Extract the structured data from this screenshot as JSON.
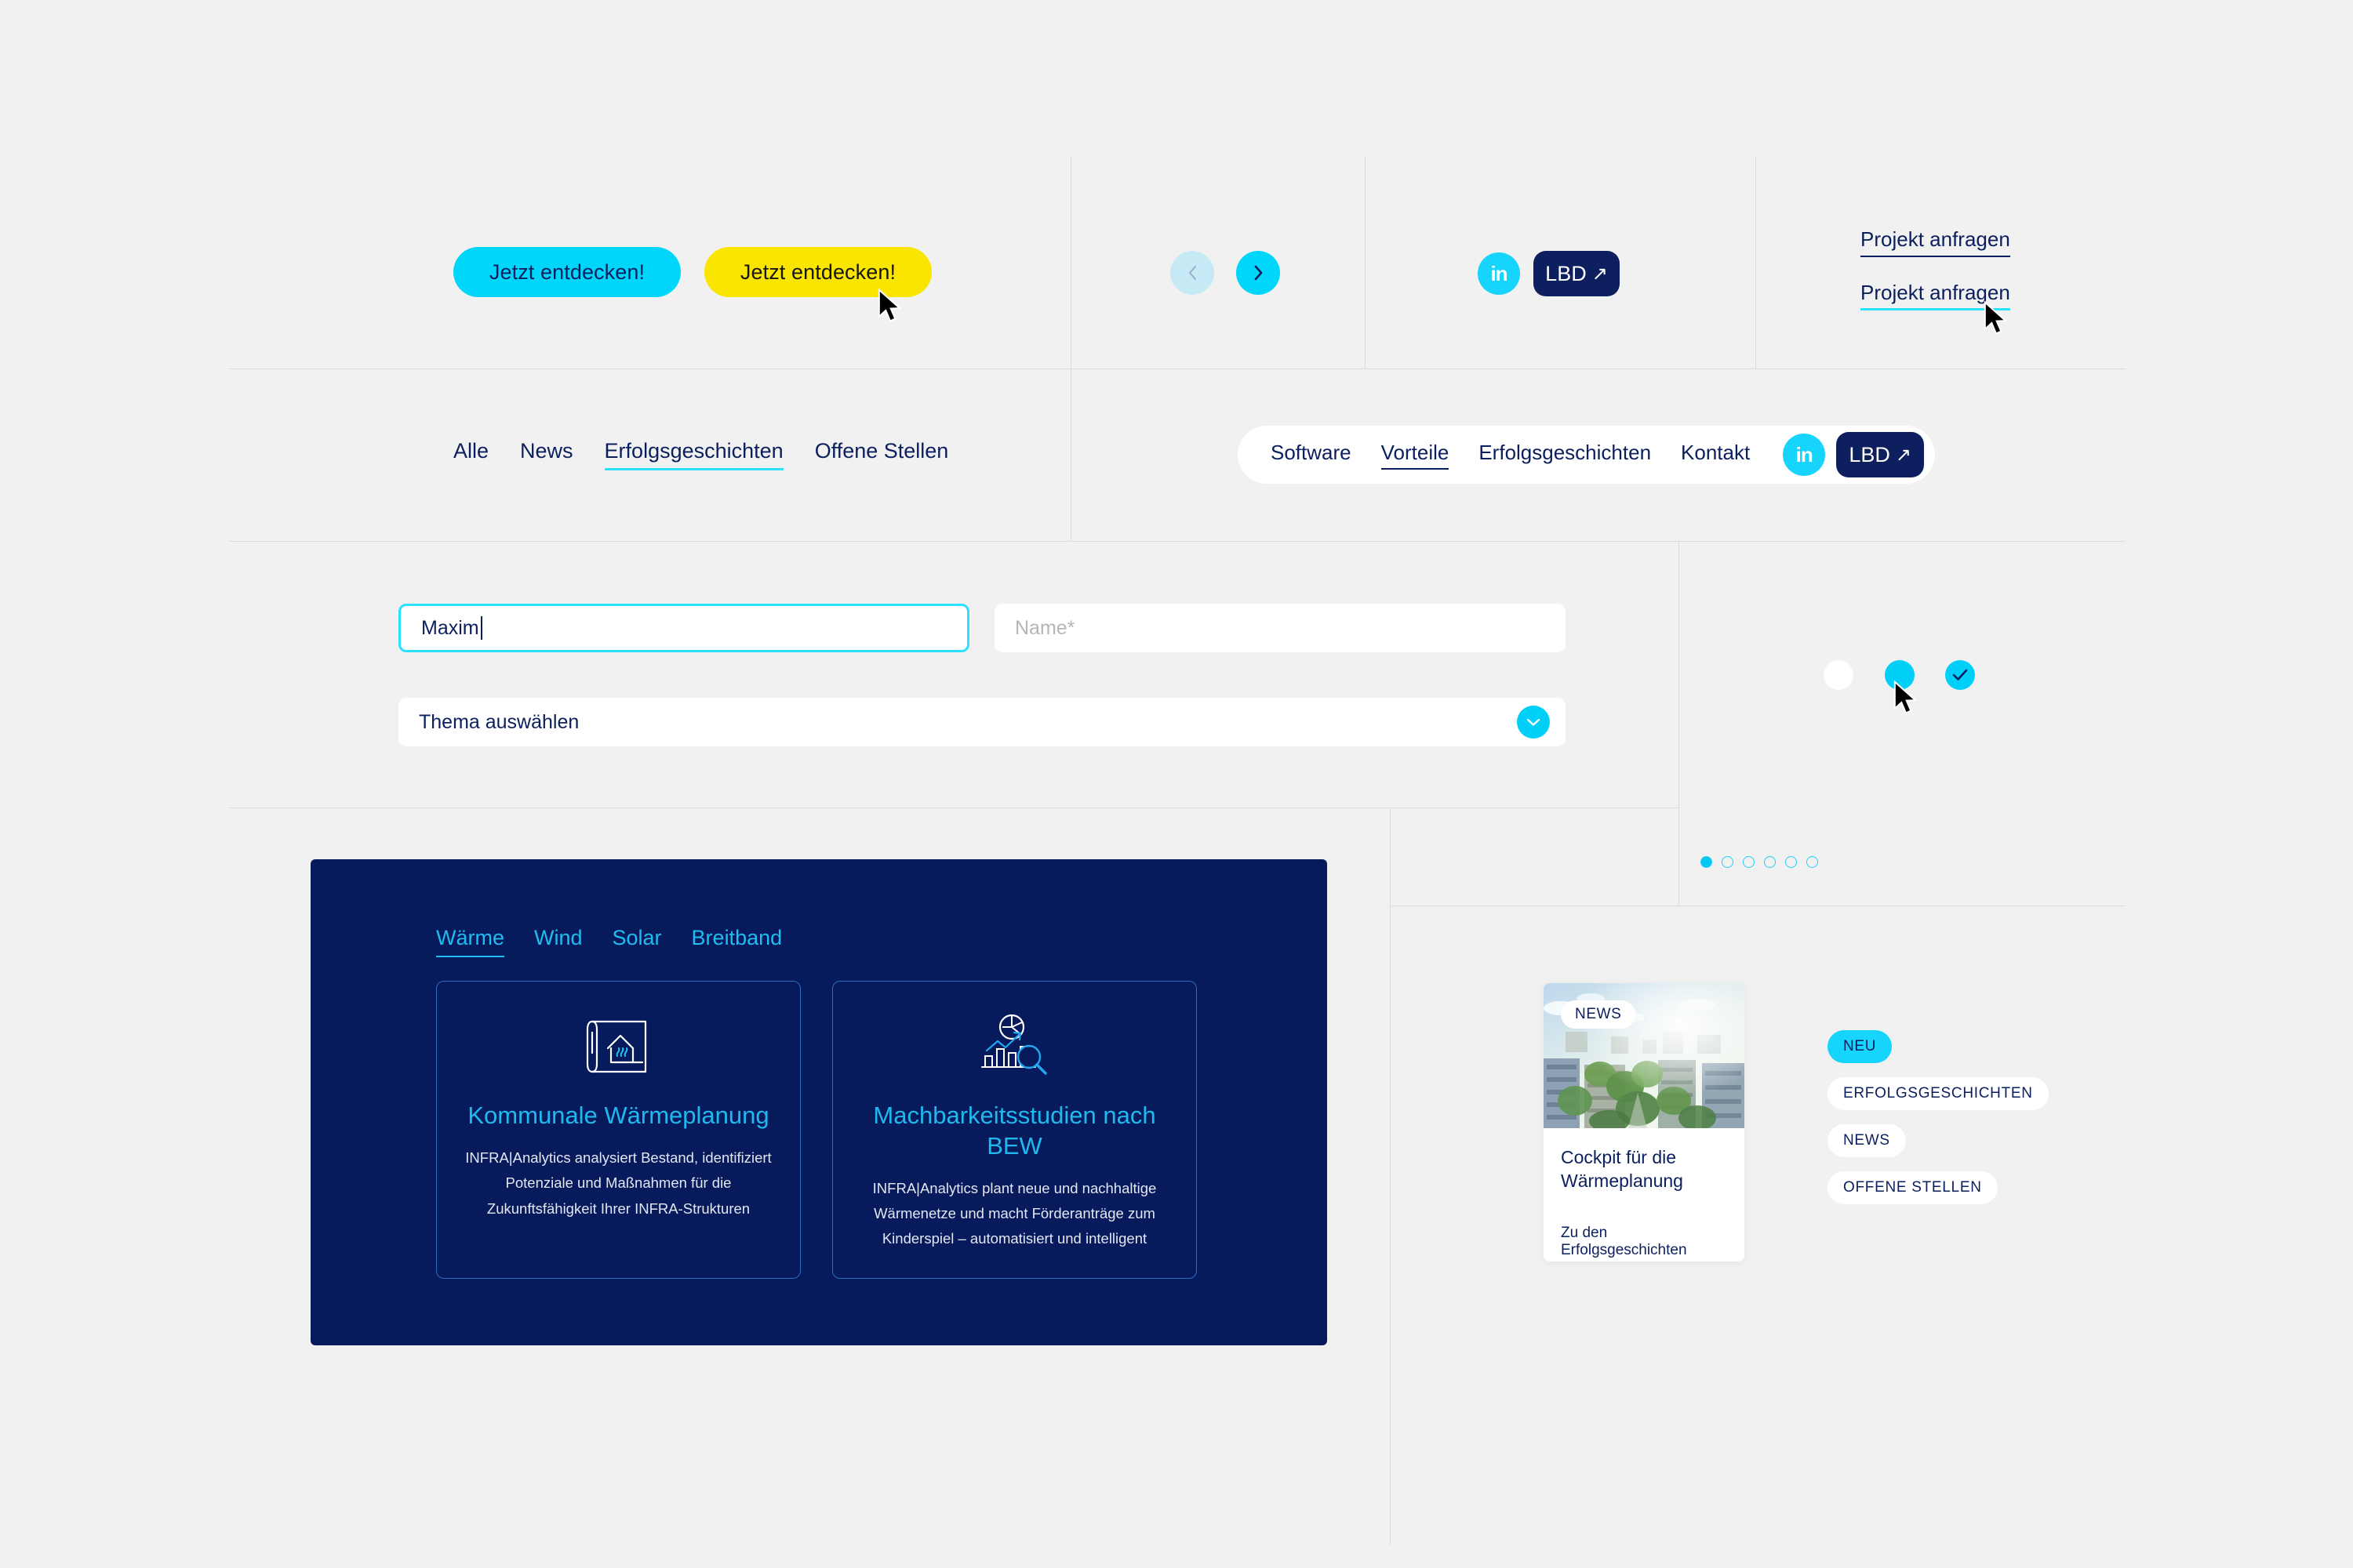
{
  "hero": {
    "button_primary": "Jetzt entdecken!",
    "button_secondary": "Jetzt entdecken!",
    "prev_icon": "chevron-left-icon",
    "next_icon": "chevron-right-icon",
    "linkedin_label": "in",
    "lbd_label": "LBD",
    "lbd_arrow": "↗",
    "link_default": "Projekt anfragen",
    "link_hover": "Projekt anfragen"
  },
  "filters": {
    "items": [
      {
        "label": "Alle",
        "active": false
      },
      {
        "label": "News",
        "active": false
      },
      {
        "label": "Erfolgsgeschichten",
        "active": true
      },
      {
        "label": "Offene Stellen",
        "active": false
      }
    ]
  },
  "nav": {
    "items": [
      {
        "label": "Software",
        "active": false
      },
      {
        "label": "Vorteile",
        "active": true
      },
      {
        "label": "Erfolgsgeschichten",
        "active": false
      },
      {
        "label": "Kontakt",
        "active": false
      }
    ],
    "linkedin_label": "in",
    "lbd_label": "LBD",
    "lbd_arrow": "↗"
  },
  "form": {
    "first_value": "Maxim",
    "second_placeholder": "Name*",
    "select_label": "Thema auswählen",
    "chevron_icon": "chevron-down-icon"
  },
  "checkboxes": {
    "states": [
      "empty",
      "hover",
      "checked"
    ],
    "check_icon": "check-icon"
  },
  "panel": {
    "tabs": [
      {
        "label": "Wärme",
        "active": true
      },
      {
        "label": "Wind",
        "active": false
      },
      {
        "label": "Solar",
        "active": false
      },
      {
        "label": "Breitband",
        "active": false
      }
    ],
    "cards": [
      {
        "icon": "blueprint-house-heat-icon",
        "title": "Kommunale Wärmeplanung",
        "desc": "INFRA|Analytics analysiert Bestand, identifiziert Potenziale und Maßnahmen für die Zukunftsfähigkeit Ihrer INFRA-Strukturen"
      },
      {
        "icon": "analytics-chart-magnifier-icon",
        "title": "Machbarkeitsstudien nach BEW",
        "desc": "INFRA|Analytics plant neue und nachhaltige Wärmenetze und macht Förderanträge zum Kinderspiel – automatisiert und intelligent"
      }
    ]
  },
  "carousel": {
    "dots": 6,
    "active_index": 0
  },
  "news_card": {
    "badge": "NEWS",
    "title": "Cockpit für die Wärmeplanung",
    "link": "Zu den Erfolgsgeschichten",
    "image_alt": "green-urban-buildings-photo"
  },
  "tags": [
    {
      "label": "NEU",
      "style": "cyan"
    },
    {
      "label": "ERFOLGSGESCHICHTEN",
      "style": "white"
    },
    {
      "label": "NEWS",
      "style": "white"
    },
    {
      "label": "OFFENE STELLEN",
      "style": "white"
    }
  ],
  "colors": {
    "background": "#f1f1f1",
    "navy": "#0b1f5e",
    "panel_navy": "#061a5c",
    "cyan": "#00d5fa",
    "cyan_soft": "#c5eaf5",
    "yellow": "#f9e500",
    "white": "#ffffff",
    "divider": "#dcdcdc"
  }
}
